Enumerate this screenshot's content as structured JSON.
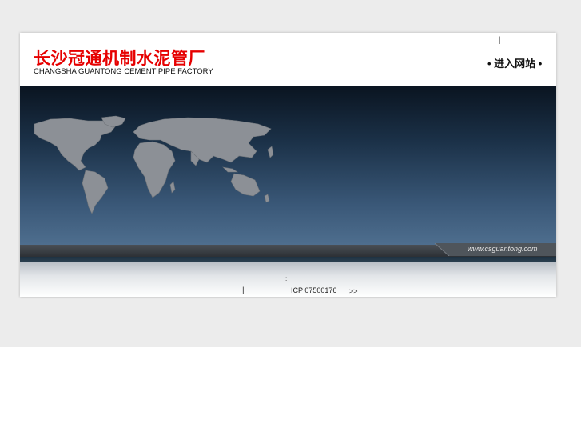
{
  "header": {
    "title_cn": "长沙冠通机制水泥管厂",
    "title_en": "CHANGSHA GUANTONG CEMENT PIPE FACTORY",
    "top_separator": "|",
    "enter_link": "• 进入网站 •"
  },
  "banner": {
    "site_url": "www.csguantong.com"
  },
  "footer": {
    "colon": ":",
    "separator": "|",
    "icp": "ICP 07500176",
    "more": ">>"
  },
  "colors": {
    "title_red": "#e60000",
    "banner_top": "#0a1420",
    "banner_bottom": "#4e6e8e",
    "map_land": "#8c9096",
    "page_band": "#ececec"
  },
  "icons": {
    "world_map": "world-map-icon"
  }
}
